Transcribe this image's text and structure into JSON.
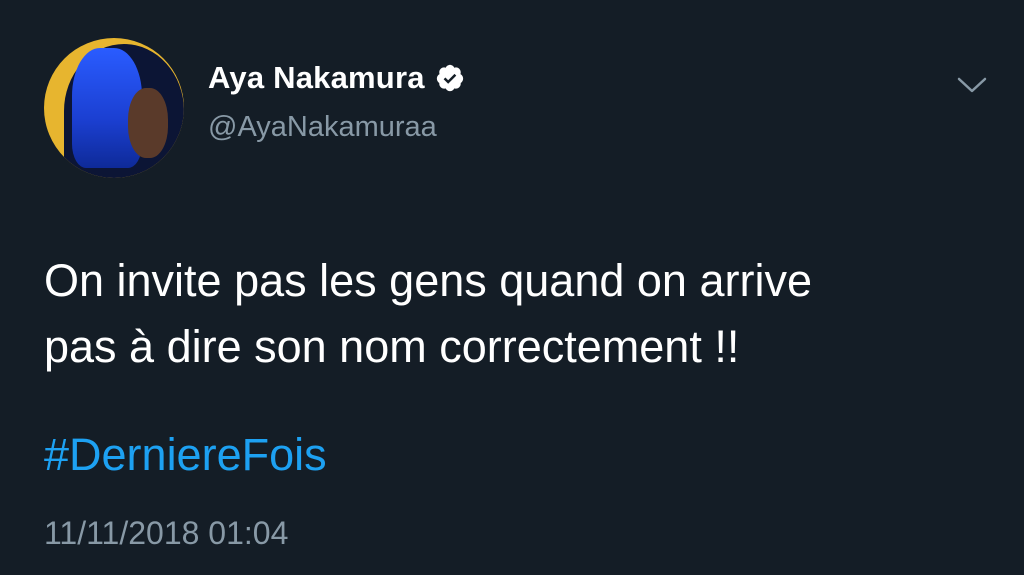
{
  "tweet": {
    "author": {
      "display_name": "Aya Nakamura",
      "handle": "@AyaNakamuraa",
      "verified": true,
      "avatar_icon": "profile-avatar"
    },
    "menu_icon": "chevron-down-icon",
    "text_lines": [
      "On invite pas les gens quand on arrive",
      "pas à dire son nom correctement !!"
    ],
    "hashtag": "#DerniereFois",
    "timestamp": "11/11/2018 01:04"
  },
  "colors": {
    "background": "#141d26",
    "primary_text": "#ffffff",
    "secondary_text": "#8899a6",
    "link": "#1da1f2",
    "avatar_ring": "#e7b52f"
  }
}
